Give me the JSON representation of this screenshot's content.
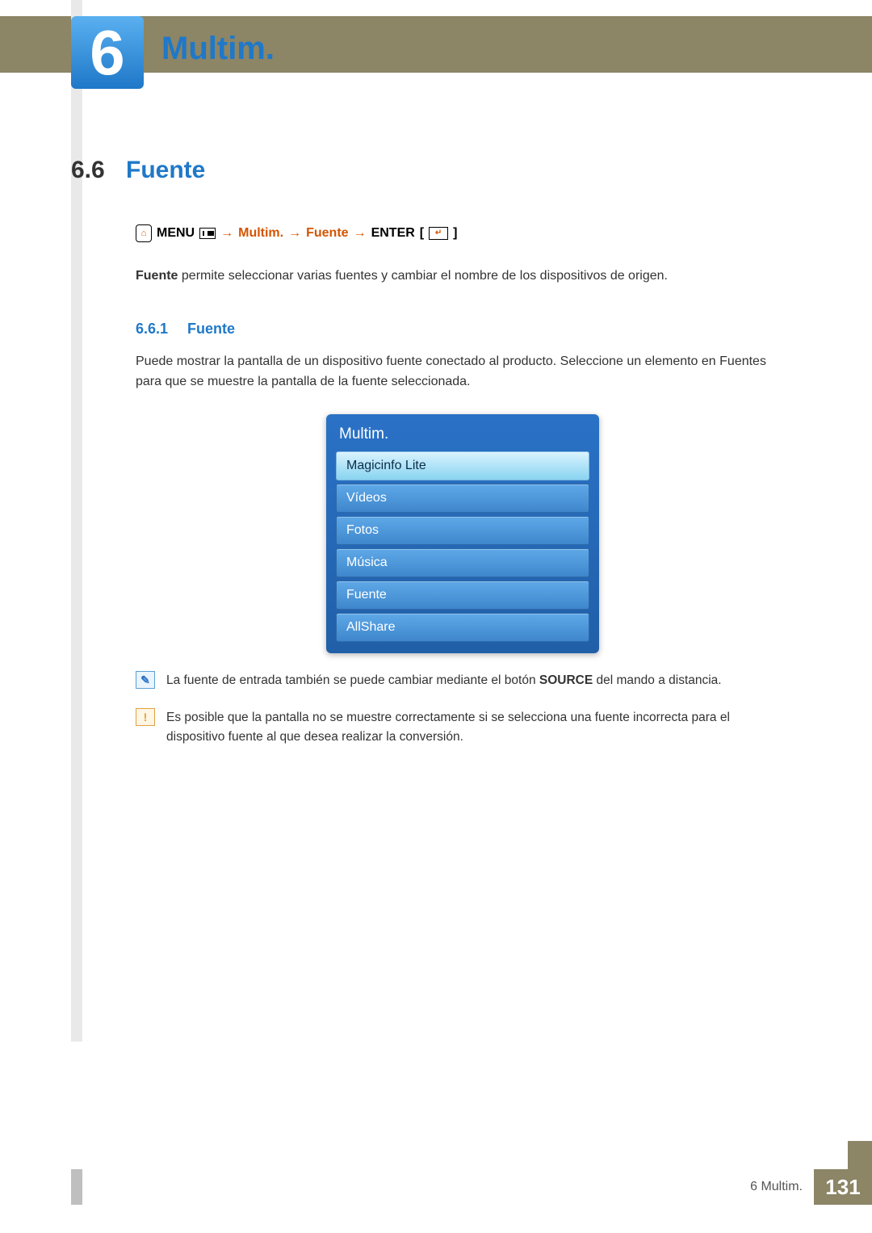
{
  "chapter": {
    "number": "6",
    "title": "Multim."
  },
  "section": {
    "number": "6.6",
    "title": "Fuente"
  },
  "navpath": {
    "menu": "MENU",
    "arrow": "→",
    "seg1": "Multim.",
    "seg2": "Fuente",
    "enter": "ENTER"
  },
  "intro": "Fuente permite seleccionar varias fuentes y cambiar el nombre de los dispositivos de origen.",
  "subsection": {
    "number": "6.6.1",
    "title": "Fuente"
  },
  "subintro": "Puede mostrar la pantalla de un dispositivo fuente conectado al producto. Seleccione un elemento en Fuentes para que se muestre la pantalla de la fuente seleccionada.",
  "menu": {
    "title": "Multim.",
    "items": [
      {
        "label": "Magicinfo Lite",
        "selected": true
      },
      {
        "label": "Vídeos",
        "selected": false
      },
      {
        "label": "Fotos",
        "selected": false
      },
      {
        "label": "Música",
        "selected": false
      },
      {
        "label": "Fuente",
        "selected": false
      },
      {
        "label": "AllShare",
        "selected": false
      }
    ]
  },
  "noteInfo": {
    "pre": "La fuente de entrada también se puede cambiar mediante el botón ",
    "bold": "SOURCE",
    "post": " del mando a distancia."
  },
  "noteWarn": "Es posible que la pantalla no se muestre correctamente si se selecciona una fuente incorrecta para el dispositivo fuente al que desea realizar la conversión.",
  "footer": {
    "chapter": "6 Multim.",
    "page": "131"
  }
}
